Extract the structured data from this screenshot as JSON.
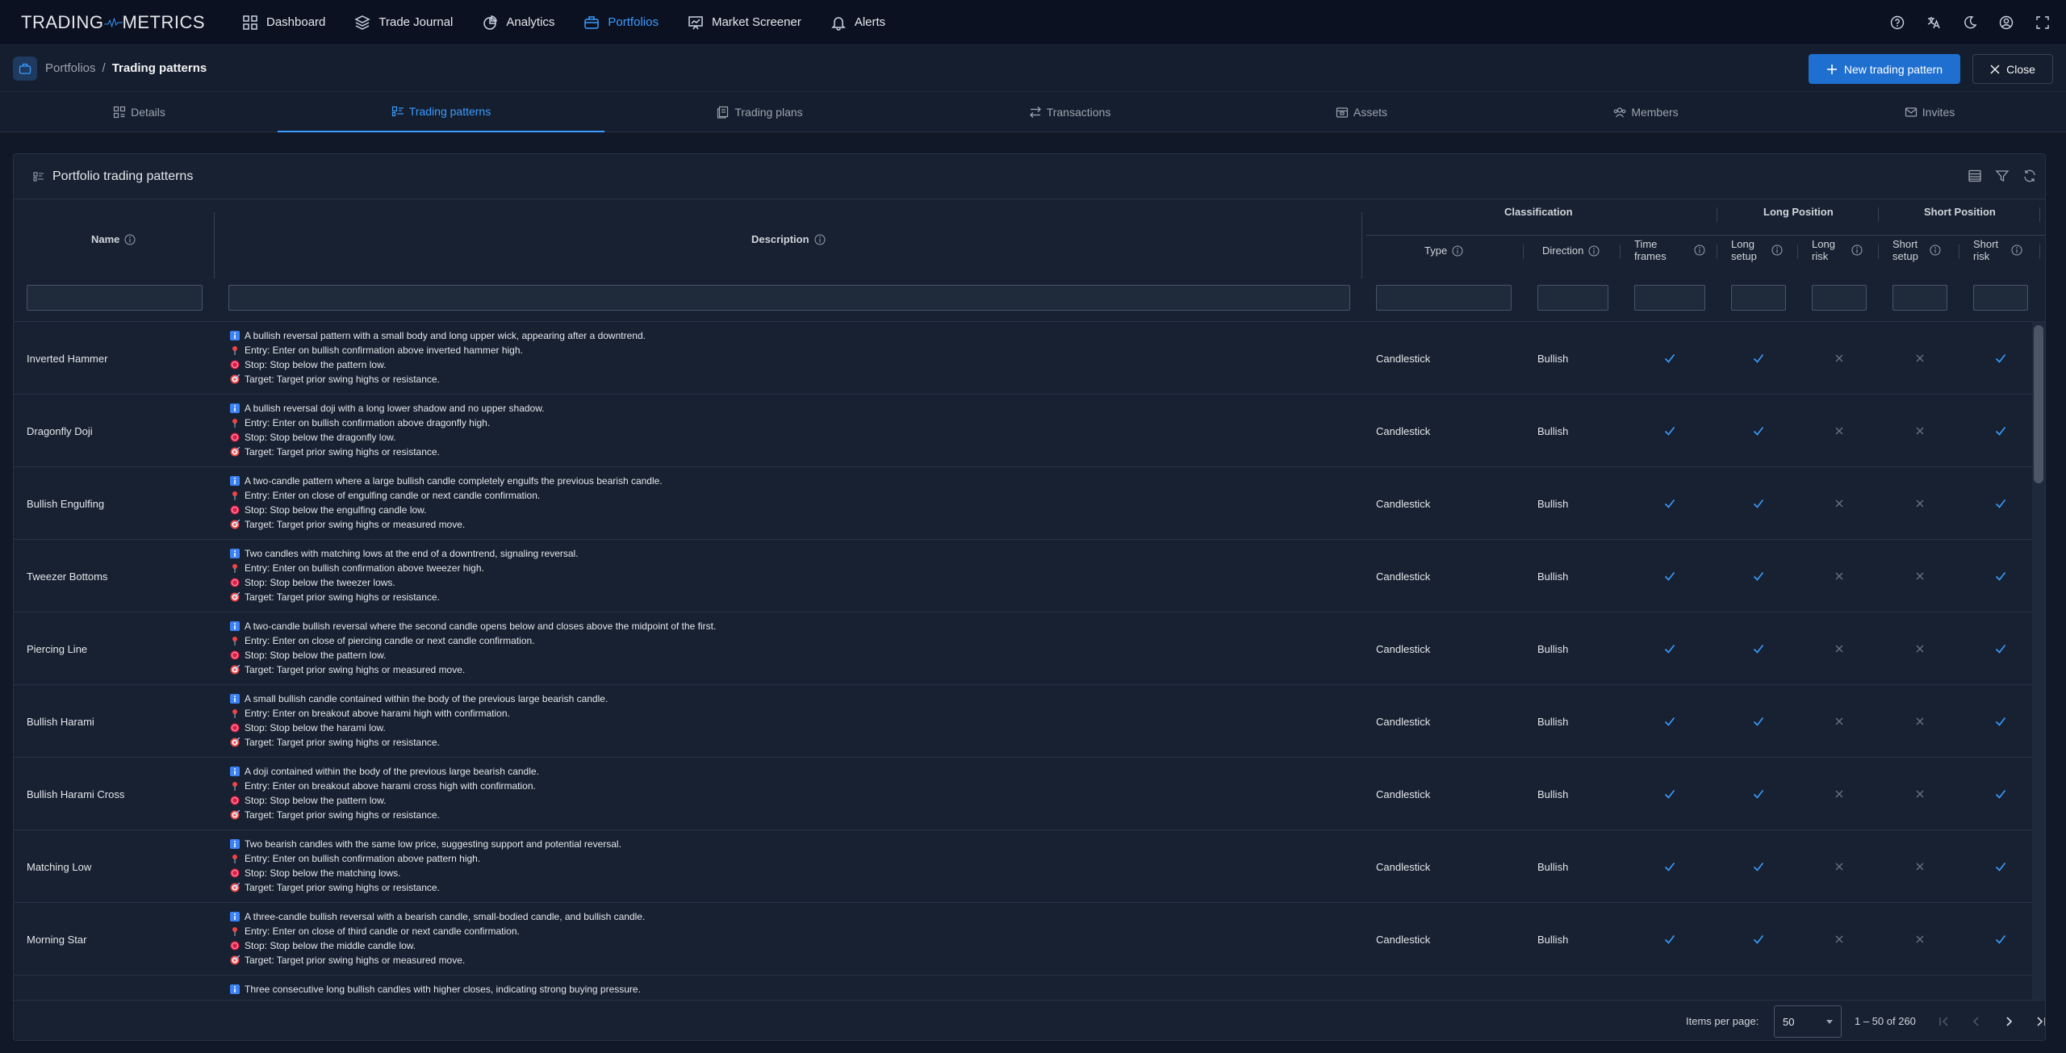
{
  "brand": {
    "left": "TRADING",
    "right": "METRICS"
  },
  "nav": [
    {
      "label": "Dashboard",
      "icon": "grid-icon"
    },
    {
      "label": "Trade Journal",
      "icon": "layers-icon"
    },
    {
      "label": "Analytics",
      "icon": "pie-chart-icon"
    },
    {
      "label": "Portfolios",
      "icon": "briefcase-icon",
      "active": true
    },
    {
      "label": "Market Screener",
      "icon": "presentation-chart-icon"
    },
    {
      "label": "Alerts",
      "icon": "bell-icon"
    }
  ],
  "breadcrumb": {
    "root": "Portfolios",
    "separator": "/",
    "current": "Trading patterns"
  },
  "actions": {
    "new_label": "New trading pattern",
    "close_label": "Close"
  },
  "tabs": [
    {
      "label": "Details"
    },
    {
      "label": "Trading patterns",
      "active": true
    },
    {
      "label": "Trading plans"
    },
    {
      "label": "Transactions"
    },
    {
      "label": "Assets"
    },
    {
      "label": "Members"
    },
    {
      "label": "Invites"
    }
  ],
  "panel": {
    "title": "Portfolio trading patterns"
  },
  "columns": {
    "name": "Name",
    "description": "Description",
    "group_classification": "Classification",
    "group_long": "Long Position",
    "group_short": "Short Position",
    "type": "Type",
    "direction": "Direction",
    "time_frames_1": "Time",
    "time_frames_2": "frames",
    "long_setup_1": "Long",
    "long_setup_2": "setup",
    "long_risk_1": "Long",
    "long_risk_2": "risk",
    "short_setup_1": "Short",
    "short_setup_2": "setup",
    "short_risk_1": "Short",
    "short_risk_2": "risk"
  },
  "rows": [
    {
      "name": "Inverted Hammer",
      "d1": "A bullish reversal pattern with a small body and long upper wick, appearing after a downtrend.",
      "d2": "Entry: Enter on bullish confirmation above inverted hammer high.",
      "d3": "Stop: Stop below the pattern low.",
      "d4": "Target: Target prior swing highs or resistance.",
      "type": "Candlestick",
      "direction": "Bullish"
    },
    {
      "name": "Dragonfly Doji",
      "d1": "A bullish reversal doji with a long lower shadow and no upper shadow.",
      "d2": "Entry: Enter on bullish confirmation above dragonfly high.",
      "d3": "Stop: Stop below the dragonfly low.",
      "d4": "Target: Target prior swing highs or resistance.",
      "type": "Candlestick",
      "direction": "Bullish"
    },
    {
      "name": "Bullish Engulfing",
      "d1": "A two-candle pattern where a large bullish candle completely engulfs the previous bearish candle.",
      "d2": "Entry: Enter on close of engulfing candle or next candle confirmation.",
      "d3": "Stop: Stop below the engulfing candle low.",
      "d4": "Target: Target prior swing highs or measured move.",
      "type": "Candlestick",
      "direction": "Bullish"
    },
    {
      "name": "Tweezer Bottoms",
      "d1": "Two candles with matching lows at the end of a downtrend, signaling reversal.",
      "d2": "Entry: Enter on bullish confirmation above tweezer high.",
      "d3": "Stop: Stop below the tweezer lows.",
      "d4": "Target: Target prior swing highs or resistance.",
      "type": "Candlestick",
      "direction": "Bullish"
    },
    {
      "name": "Piercing Line",
      "d1": "A two-candle bullish reversal where the second candle opens below and closes above the midpoint of the first.",
      "d2": "Entry: Enter on close of piercing candle or next candle confirmation.",
      "d3": "Stop: Stop below the pattern low.",
      "d4": "Target: Target prior swing highs or measured move.",
      "type": "Candlestick",
      "direction": "Bullish"
    },
    {
      "name": "Bullish Harami",
      "d1": "A small bullish candle contained within the body of the previous large bearish candle.",
      "d2": "Entry: Enter on breakout above harami high with confirmation.",
      "d3": "Stop: Stop below the harami low.",
      "d4": "Target: Target prior swing highs or resistance.",
      "type": "Candlestick",
      "direction": "Bullish"
    },
    {
      "name": "Bullish Harami Cross",
      "d1": "A doji contained within the body of the previous large bearish candle.",
      "d2": "Entry: Enter on breakout above harami cross high with confirmation.",
      "d3": "Stop: Stop below the pattern low.",
      "d4": "Target: Target prior swing highs or resistance.",
      "type": "Candlestick",
      "direction": "Bullish"
    },
    {
      "name": "Matching Low",
      "d1": "Two bearish candles with the same low price, suggesting support and potential reversal.",
      "d2": "Entry: Enter on bullish confirmation above pattern high.",
      "d3": "Stop: Stop below the matching lows.",
      "d4": "Target: Target prior swing highs or resistance.",
      "type": "Candlestick",
      "direction": "Bullish"
    },
    {
      "name": "Morning Star",
      "d1": "A three-candle bullish reversal with a bearish candle, small-bodied candle, and bullish candle.",
      "d2": "Entry: Enter on close of third candle or next candle confirmation.",
      "d3": "Stop: Stop below the middle candle low.",
      "d4": "Target: Target prior swing highs or measured move.",
      "type": "Candlestick",
      "direction": "Bullish"
    },
    {
      "name": "",
      "d1": "Three consecutive long bullish candles with higher closes, indicating strong buying pressure.",
      "d2": "",
      "d3": "",
      "d4": "",
      "type": "",
      "direction": ""
    }
  ],
  "flags": {
    "time_frames": true,
    "long_setup": true,
    "long_risk": false,
    "short_setup": false,
    "short_risk": true
  },
  "pagination": {
    "label": "Items per page:",
    "per_page": "50",
    "range": "1 – 50 of 260"
  },
  "colors": {
    "accent": "#3b9cff",
    "primary_button": "#1f6fd1",
    "check": "#3b9cff",
    "cross": "#6b7280"
  }
}
